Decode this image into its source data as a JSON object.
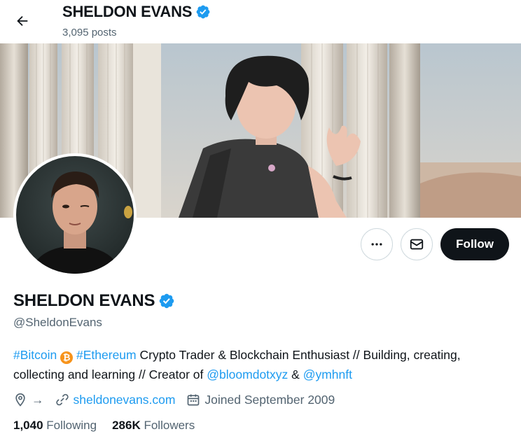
{
  "header": {
    "name": "SHELDON EVANS",
    "posts": "3,095 posts"
  },
  "profile": {
    "name": "SHELDON EVANS",
    "handle": "@SheldonEvans",
    "bio": {
      "tag1": "#Bitcoin",
      "bitcoin_glyph": "₿",
      "tag2": "#Ethereum",
      "text1": " Crypto Trader & Blockchain Enthusiast // Building, creating, collecting and learning // Creator of ",
      "mention1": "@bloomdotxyz",
      "text2": " & ",
      "mention2": "@ymhnft"
    },
    "location_arrow": "→",
    "website": "sheldonevans.com",
    "joined": "Joined September 2009",
    "following_count": "1,040",
    "following_label": "Following",
    "followers_count": "286K",
    "followers_label": "Followers"
  },
  "actions": {
    "follow_label": "Follow"
  },
  "colors": {
    "accent": "#1d9bf0",
    "bitcoin": "#f7931a",
    "text": "#0f1419",
    "muted": "#536471"
  },
  "icons": [
    "back-arrow-icon",
    "verified-badge-icon",
    "more-dots-icon",
    "mail-icon",
    "location-pin-icon",
    "link-icon",
    "calendar-icon",
    "bitcoin-icon"
  ]
}
